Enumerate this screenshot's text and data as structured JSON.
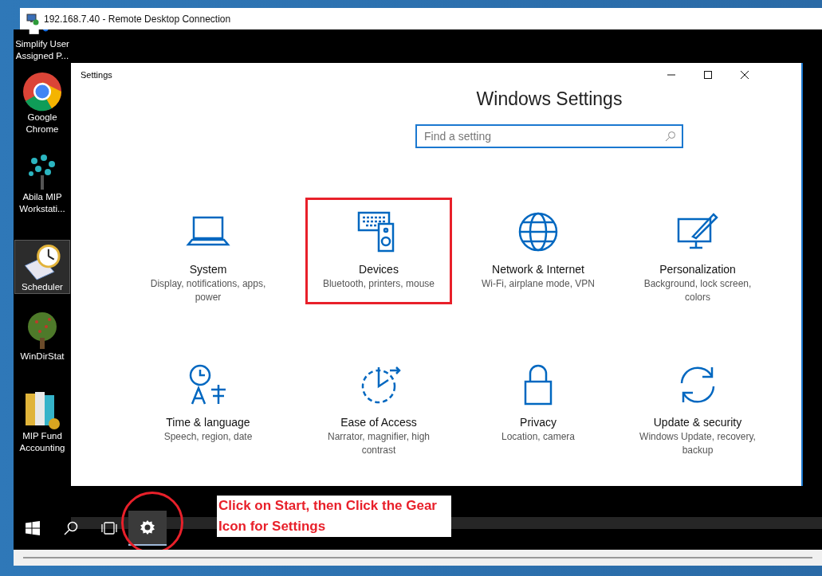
{
  "rdp_window": {
    "title": "192.168.7.40 - Remote Desktop Connection"
  },
  "desktop_icons": [
    {
      "kind": "shortcut",
      "label": "Simplify User Assigned P...",
      "selected": false
    },
    {
      "kind": "chrome",
      "label": "Google Chrome",
      "selected": false
    },
    {
      "kind": "dots",
      "label": "Abila MIP Workstati...",
      "selected": false
    },
    {
      "kind": "scheduler",
      "label": "Scheduler",
      "selected": true
    },
    {
      "kind": "tree",
      "label": "WinDirStat",
      "selected": false
    },
    {
      "kind": "books",
      "label": "MIP Fund Accounting",
      "selected": false
    }
  ],
  "settings_window": {
    "title": "Settings",
    "heading": "Windows Settings",
    "search": {
      "placeholder": "Find a setting"
    },
    "categories": [
      {
        "kind": "laptop",
        "title": "System",
        "description": "Display, notifications, apps, power",
        "highlighted": false
      },
      {
        "kind": "devices",
        "title": "Devices",
        "description": "Bluetooth, printers, mouse",
        "highlighted": true
      },
      {
        "kind": "globe",
        "title": "Network & Internet",
        "description": "Wi-Fi, airplane mode, VPN",
        "highlighted": false
      },
      {
        "kind": "paint",
        "title": "Personalization",
        "description": "Background, lock screen, colors",
        "highlighted": false
      },
      {
        "kind": "time",
        "title": "Time & language",
        "description": "Speech, region, date",
        "highlighted": false
      },
      {
        "kind": "ease",
        "title": "Ease of Access",
        "description": "Narrator, magnifier, high contrast",
        "highlighted": false
      },
      {
        "kind": "lock",
        "title": "Privacy",
        "description": "Location, camera",
        "highlighted": false
      },
      {
        "kind": "sync",
        "title": "Update & security",
        "description": "Windows Update, recovery, backup",
        "highlighted": false
      }
    ]
  },
  "taskbar": {
    "buttons": [
      {
        "kind": "start",
        "selected": false
      },
      {
        "kind": "search",
        "selected": false
      },
      {
        "kind": "taskview",
        "selected": false
      },
      {
        "kind": "settings",
        "selected": true
      }
    ]
  },
  "annotation": {
    "text": "Click on Start, then Click the Gear Icon for Settings"
  }
}
